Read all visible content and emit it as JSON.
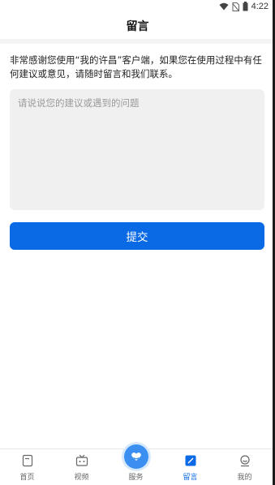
{
  "status_bar": {
    "time": "4:22",
    "icons": [
      "wifi-icon",
      "no-sim-icon",
      "battery-icon"
    ]
  },
  "header": {
    "title": "留言"
  },
  "intro_text": "非常感谢您使用“我的许昌”客户端，如果您在使用过程中有任何建议或意见，请随时留言和我们联系。",
  "feedback": {
    "placeholder": "请说说您的建议或遇到的问题",
    "value": ""
  },
  "submit_label": "提交",
  "colors": {
    "accent": "#0a6ae6",
    "input_bg": "#f0f0f0"
  },
  "tabbar": {
    "items": [
      {
        "label": "首页",
        "icon": "home-page-icon",
        "active": false
      },
      {
        "label": "视频",
        "icon": "tv-icon",
        "active": false
      },
      {
        "label": "服务",
        "icon": "service-heart-icon",
        "active": false
      },
      {
        "label": "留言",
        "icon": "message-edit-icon",
        "active": true
      },
      {
        "label": "我的",
        "icon": "profile-icon",
        "active": false
      }
    ]
  }
}
